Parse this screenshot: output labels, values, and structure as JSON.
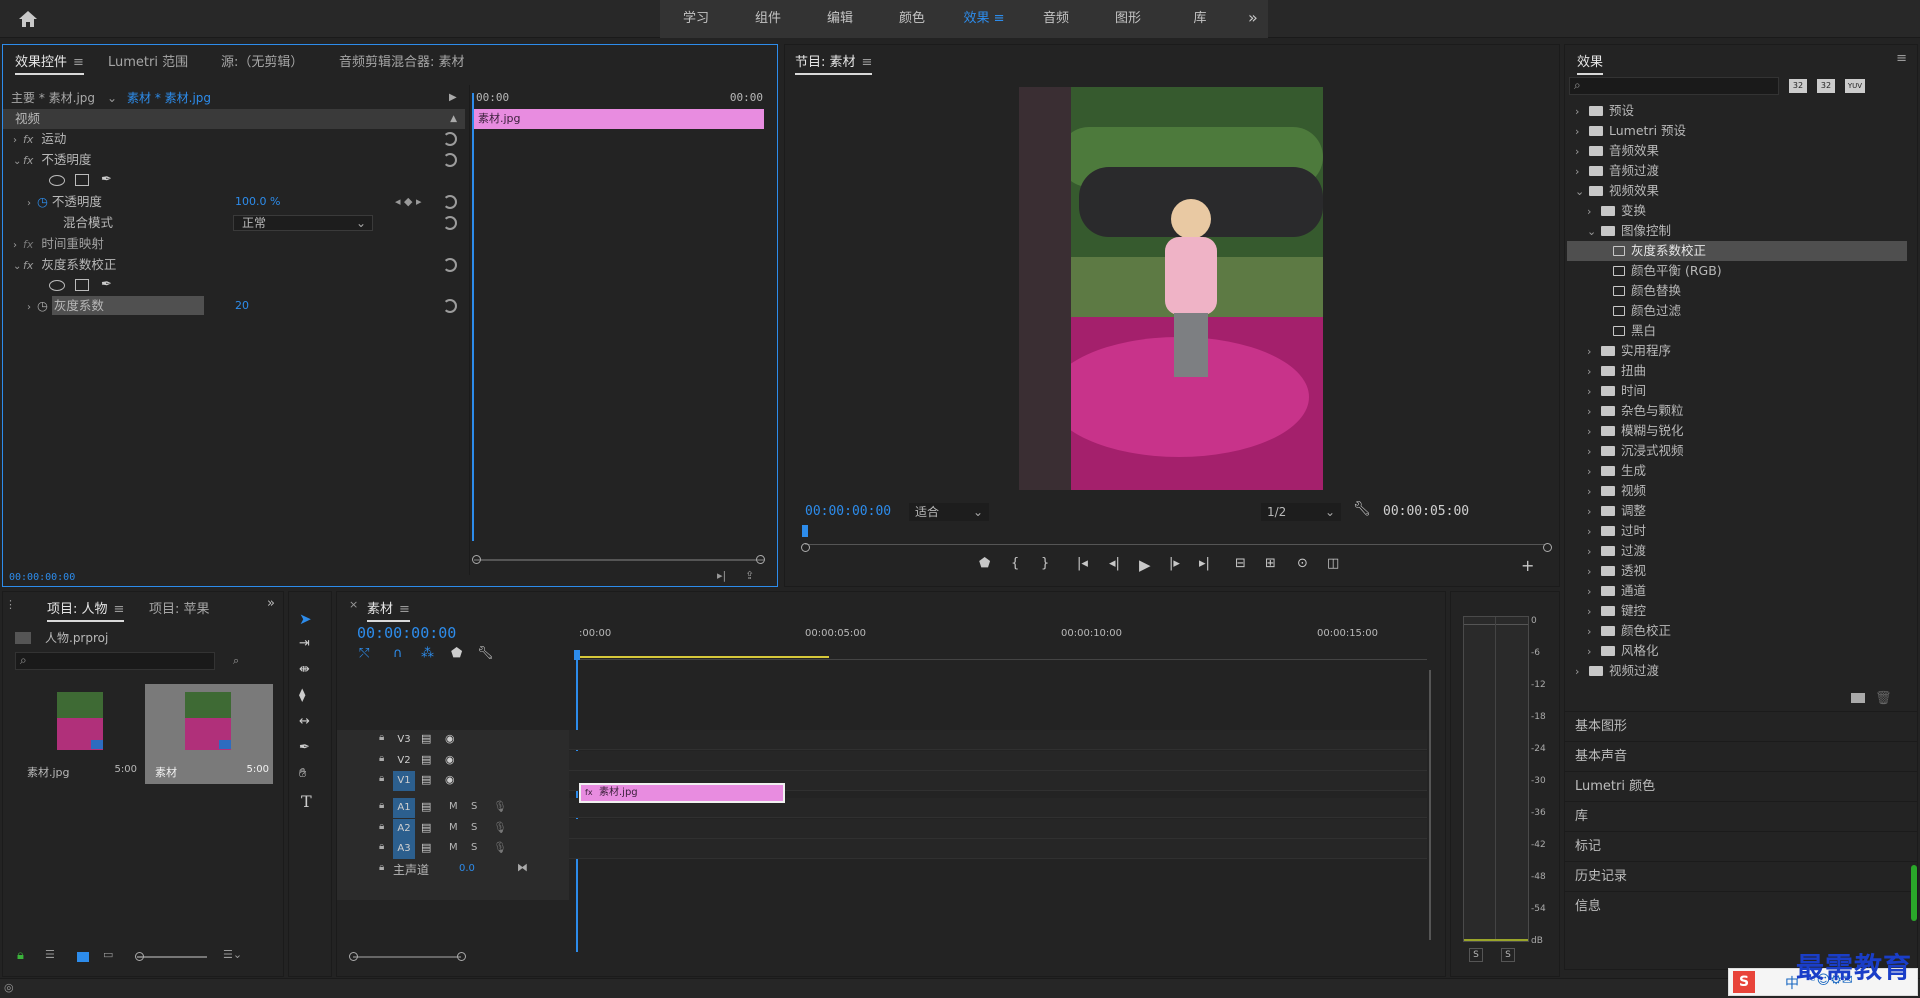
{
  "workspaces": {
    "items": [
      "学习",
      "组件",
      "编辑",
      "颜色",
      "效果",
      "音频",
      "图形",
      "库"
    ],
    "active": "效果"
  },
  "effect_controls": {
    "tabs": [
      "效果控件",
      "Lumetri 范围",
      "源:（无剪辑）",
      "音频剪辑混合器: 素材"
    ],
    "source_master": "主要 * 素材.jpg",
    "source_clip": "素材 * 素材.jpg",
    "tc_left": "00:00",
    "tc_right": "00:00",
    "clip_label": "素材.jpg",
    "section_video": "视频",
    "motion": "运动",
    "opacity_group": "不透明度",
    "opacity": "不透明度",
    "opacity_value": "100.0 %",
    "blend": "混合模式",
    "blend_value": "正常",
    "time_remap": "时间重映射",
    "gamma_group": "灰度系数校正",
    "gamma": "灰度系数",
    "gamma_value": "20",
    "timecode": "00:00:00:00"
  },
  "program": {
    "title": "节目: 素材",
    "timecode": "00:00:00:00",
    "fit": "适合",
    "quality": "1/2",
    "duration": "00:00:05:00"
  },
  "effects_panel": {
    "title": "效果",
    "search_placeholder": "",
    "badges": [
      "32",
      "32",
      "YUV"
    ],
    "tree": [
      {
        "label": "预设",
        "level": 0,
        "type": "folder",
        "state": "closed"
      },
      {
        "label": "Lumetri 预设",
        "level": 0,
        "type": "folder",
        "state": "closed"
      },
      {
        "label": "音频效果",
        "level": 0,
        "type": "folder",
        "state": "closed"
      },
      {
        "label": "音频过渡",
        "level": 0,
        "type": "folder",
        "state": "closed"
      },
      {
        "label": "视频效果",
        "level": 0,
        "type": "folder",
        "state": "open"
      },
      {
        "label": "变换",
        "level": 1,
        "type": "folder",
        "state": "closed"
      },
      {
        "label": "图像控制",
        "level": 1,
        "type": "folder",
        "state": "open"
      },
      {
        "label": "灰度系数校正",
        "level": 2,
        "type": "fx",
        "state": "selected"
      },
      {
        "label": "颜色平衡 (RGB)",
        "level": 2,
        "type": "fx",
        "state": ""
      },
      {
        "label": "颜色替换",
        "level": 2,
        "type": "fx",
        "state": ""
      },
      {
        "label": "颜色过滤",
        "level": 2,
        "type": "fx",
        "state": ""
      },
      {
        "label": "黑白",
        "level": 2,
        "type": "fx",
        "state": ""
      },
      {
        "label": "实用程序",
        "level": 1,
        "type": "folder",
        "state": "closed"
      },
      {
        "label": "扭曲",
        "level": 1,
        "type": "folder",
        "state": "closed"
      },
      {
        "label": "时间",
        "level": 1,
        "type": "folder",
        "state": "closed"
      },
      {
        "label": "杂色与颗粒",
        "level": 1,
        "type": "folder",
        "state": "closed"
      },
      {
        "label": "模糊与锐化",
        "level": 1,
        "type": "folder",
        "state": "closed"
      },
      {
        "label": "沉浸式视频",
        "level": 1,
        "type": "folder",
        "state": "closed"
      },
      {
        "label": "生成",
        "level": 1,
        "type": "folder",
        "state": "closed"
      },
      {
        "label": "视频",
        "level": 1,
        "type": "folder",
        "state": "closed"
      },
      {
        "label": "调整",
        "level": 1,
        "type": "folder",
        "state": "closed"
      },
      {
        "label": "过时",
        "level": 1,
        "type": "folder",
        "state": "closed"
      },
      {
        "label": "过渡",
        "level": 1,
        "type": "folder",
        "state": "closed"
      },
      {
        "label": "透视",
        "level": 1,
        "type": "folder",
        "state": "closed"
      },
      {
        "label": "通道",
        "level": 1,
        "type": "folder",
        "state": "closed"
      },
      {
        "label": "键控",
        "level": 1,
        "type": "folder",
        "state": "closed"
      },
      {
        "label": "颜色校正",
        "level": 1,
        "type": "folder",
        "state": "closed"
      },
      {
        "label": "风格化",
        "level": 1,
        "type": "folder",
        "state": "closed"
      },
      {
        "label": "视频过渡",
        "level": 0,
        "type": "folder",
        "state": "closed"
      }
    ],
    "collapsed_panels": [
      "基本图形",
      "基本声音",
      "Lumetri 颜色",
      "库",
      "标记",
      "历史记录",
      "信息"
    ]
  },
  "project": {
    "tabs": [
      "项目: 人物",
      "项目: 苹果"
    ],
    "file": "人物.prproj",
    "items": [
      {
        "name": "素材.jpg",
        "duration": "5:00"
      },
      {
        "name": "素材",
        "duration": "5:00"
      }
    ]
  },
  "timeline": {
    "tab": "素材",
    "timecode": "00:00:00:00",
    "ruler": [
      ":00:00",
      "00:00:05:00",
      "00:00:10:00",
      "00:00:15:00"
    ],
    "video_tracks": [
      "V3",
      "V2",
      "V1"
    ],
    "audio_tracks": [
      "A1",
      "A2",
      "A3"
    ],
    "master": "主声道",
    "master_value": "0.0",
    "clip": "素材.jpg",
    "m": "M",
    "s": "S"
  },
  "meter": {
    "scale": [
      "0",
      "-6",
      "-12",
      "-18",
      "-24",
      "-30",
      "-36",
      "-42",
      "-48",
      "-54",
      "dB"
    ],
    "solo": [
      "S",
      "S"
    ]
  },
  "watermark": {
    "text": "最需教育",
    "ime": "中"
  }
}
